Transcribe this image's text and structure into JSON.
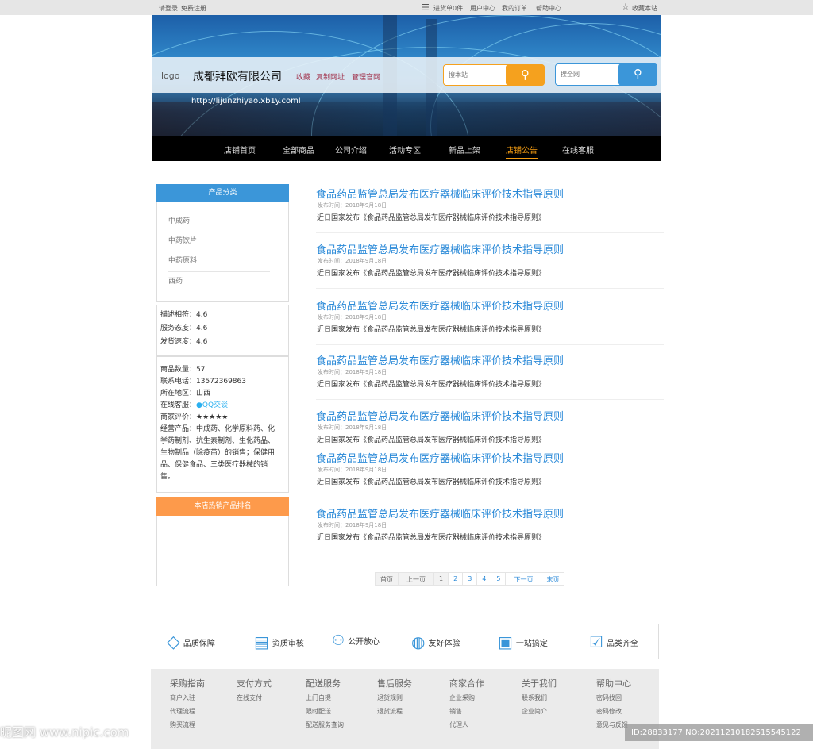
{
  "topbar": {
    "login": "请登录",
    "register": "免费注册",
    "cart": "进货单0件",
    "user_center": "用户中心",
    "orders": "我的订单",
    "help": "帮助中心",
    "favorite": "收藏本站"
  },
  "header": {
    "logo": "logo",
    "company": "成都拜欧有限公司",
    "links": [
      "收藏",
      "复制网址",
      "管理官网"
    ],
    "url": "http://lijunzhiyao.xb1y.coml",
    "search_site_placeholder": "搜本站",
    "search_all_placeholder": "搜全网"
  },
  "nav": [
    "店铺首页",
    "全部商品",
    "公司介绍",
    "活动专区",
    "新品上架",
    "店铺公告",
    "在线客服"
  ],
  "sidebar": {
    "category_title": "产品分类",
    "categories": [
      "中成药",
      "中药饮片",
      "中药原料",
      "西药"
    ],
    "ratings": [
      "描述相符：4.6",
      "服务态度：4.6",
      "发货速度：4.6"
    ],
    "info": {
      "count": "商品数量：57",
      "phone": "联系电话：13572369863",
      "region": "所在地区：山西",
      "service_label": "在线客服：",
      "qq": "QQ交谈",
      "rating": "商家评价：★★★★★",
      "products": "经营产品：中成药、化学原料药、化学药制剂、抗生素制剂、生化药品、生物制品（除疫苗）的销售；保健用品、保健食品、三类医疗器械的销售。"
    },
    "hot_title": "本店热销产品排名"
  },
  "articles": [
    {
      "title": "食品药品监管总局发布医疗器械临床评价技术指导原则",
      "date": "发布时间：2018年9月18日",
      "summary": "近日国家发布《食品药品监管总局发布医疗器械临床评价技术指导原则》"
    },
    {
      "title": "食品药品监管总局发布医疗器械临床评价技术指导原则",
      "date": "发布时间：2018年9月18日",
      "summary": "近日国家发布《食品药品监管总局发布医疗器械临床评价技术指导原则》"
    },
    {
      "title": "食品药品监管总局发布医疗器械临床评价技术指导原则",
      "date": "发布时间：2018年9月18日",
      "summary": "近日国家发布《食品药品监管总局发布医疗器械临床评价技术指导原则》"
    },
    {
      "title": "食品药品监管总局发布医疗器械临床评价技术指导原则",
      "date": "发布时间：2018年9月18日",
      "summary": "近日国家发布《食品药品监管总局发布医疗器械临床评价技术指导原则》"
    },
    {
      "title": "食品药品监管总局发布医疗器械临床评价技术指导原则",
      "date": "发布时间：2018年9月18日",
      "summary": "近日国家发布《食品药品监管总局发布医疗器械临床评价技术指导原则》"
    },
    {
      "title": "食品药品监管总局发布医疗器械临床评价技术指导原则",
      "date": "发布时间：2018年9月18日",
      "summary": "近日国家发布《食品药品监管总局发布医疗器械临床评价技术指导原则》"
    },
    {
      "title": "食品药品监管总局发布医疗器械临床评价技术指导原则",
      "date": "发布时间：2018年9月18日",
      "summary": "近日国家发布《食品药品监管总局发布医疗器械临床评价技术指导原则》"
    }
  ],
  "pager": [
    "首页",
    "上一页",
    "1",
    "2",
    "3",
    "4",
    "5",
    "下一页",
    "末页"
  ],
  "features": [
    "品质保障",
    "资质审核",
    "公开放心",
    "友好体验",
    "一站搞定",
    "品类齐全"
  ],
  "footer": [
    {
      "h": "采购指南",
      "items": [
        "商户入驻",
        "代理流程",
        "购买流程"
      ]
    },
    {
      "h": "支付方式",
      "items": [
        "在线支付"
      ]
    },
    {
      "h": "配送服务",
      "items": [
        "上门自提",
        "限时配送",
        "配送服务查询"
      ]
    },
    {
      "h": "售后服务",
      "items": [
        "退货规则",
        "退货流程"
      ]
    },
    {
      "h": "商家合作",
      "items": [
        "企业采购",
        "销售",
        "代理人"
      ]
    },
    {
      "h": "关于我们",
      "items": [
        "联系我们",
        "企业简介"
      ]
    },
    {
      "h": "帮助中心",
      "items": [
        "密码找回",
        "密码修改",
        "意见与反馈"
      ]
    }
  ],
  "watermark": {
    "left": "昵图网 www.nipic.com",
    "right": "ID:28833177 NO:20211210182515545122"
  }
}
